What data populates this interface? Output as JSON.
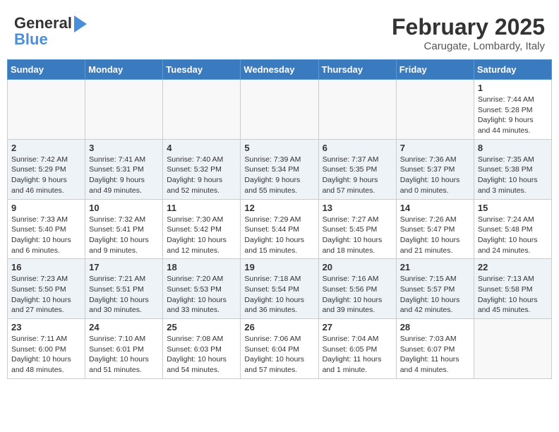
{
  "header": {
    "logo_line1": "General",
    "logo_line2": "Blue",
    "month": "February 2025",
    "location": "Carugate, Lombardy, Italy"
  },
  "days_of_week": [
    "Sunday",
    "Monday",
    "Tuesday",
    "Wednesday",
    "Thursday",
    "Friday",
    "Saturday"
  ],
  "weeks": [
    [
      {
        "day": "",
        "info": ""
      },
      {
        "day": "",
        "info": ""
      },
      {
        "day": "",
        "info": ""
      },
      {
        "day": "",
        "info": ""
      },
      {
        "day": "",
        "info": ""
      },
      {
        "day": "",
        "info": ""
      },
      {
        "day": "1",
        "info": "Sunrise: 7:44 AM\nSunset: 5:28 PM\nDaylight: 9 hours and 44 minutes."
      }
    ],
    [
      {
        "day": "2",
        "info": "Sunrise: 7:42 AM\nSunset: 5:29 PM\nDaylight: 9 hours and 46 minutes."
      },
      {
        "day": "3",
        "info": "Sunrise: 7:41 AM\nSunset: 5:31 PM\nDaylight: 9 hours and 49 minutes."
      },
      {
        "day": "4",
        "info": "Sunrise: 7:40 AM\nSunset: 5:32 PM\nDaylight: 9 hours and 52 minutes."
      },
      {
        "day": "5",
        "info": "Sunrise: 7:39 AM\nSunset: 5:34 PM\nDaylight: 9 hours and 55 minutes."
      },
      {
        "day": "6",
        "info": "Sunrise: 7:37 AM\nSunset: 5:35 PM\nDaylight: 9 hours and 57 minutes."
      },
      {
        "day": "7",
        "info": "Sunrise: 7:36 AM\nSunset: 5:37 PM\nDaylight: 10 hours and 0 minutes."
      },
      {
        "day": "8",
        "info": "Sunrise: 7:35 AM\nSunset: 5:38 PM\nDaylight: 10 hours and 3 minutes."
      }
    ],
    [
      {
        "day": "9",
        "info": "Sunrise: 7:33 AM\nSunset: 5:40 PM\nDaylight: 10 hours and 6 minutes."
      },
      {
        "day": "10",
        "info": "Sunrise: 7:32 AM\nSunset: 5:41 PM\nDaylight: 10 hours and 9 minutes."
      },
      {
        "day": "11",
        "info": "Sunrise: 7:30 AM\nSunset: 5:42 PM\nDaylight: 10 hours and 12 minutes."
      },
      {
        "day": "12",
        "info": "Sunrise: 7:29 AM\nSunset: 5:44 PM\nDaylight: 10 hours and 15 minutes."
      },
      {
        "day": "13",
        "info": "Sunrise: 7:27 AM\nSunset: 5:45 PM\nDaylight: 10 hours and 18 minutes."
      },
      {
        "day": "14",
        "info": "Sunrise: 7:26 AM\nSunset: 5:47 PM\nDaylight: 10 hours and 21 minutes."
      },
      {
        "day": "15",
        "info": "Sunrise: 7:24 AM\nSunset: 5:48 PM\nDaylight: 10 hours and 24 minutes."
      }
    ],
    [
      {
        "day": "16",
        "info": "Sunrise: 7:23 AM\nSunset: 5:50 PM\nDaylight: 10 hours and 27 minutes."
      },
      {
        "day": "17",
        "info": "Sunrise: 7:21 AM\nSunset: 5:51 PM\nDaylight: 10 hours and 30 minutes."
      },
      {
        "day": "18",
        "info": "Sunrise: 7:20 AM\nSunset: 5:53 PM\nDaylight: 10 hours and 33 minutes."
      },
      {
        "day": "19",
        "info": "Sunrise: 7:18 AM\nSunset: 5:54 PM\nDaylight: 10 hours and 36 minutes."
      },
      {
        "day": "20",
        "info": "Sunrise: 7:16 AM\nSunset: 5:56 PM\nDaylight: 10 hours and 39 minutes."
      },
      {
        "day": "21",
        "info": "Sunrise: 7:15 AM\nSunset: 5:57 PM\nDaylight: 10 hours and 42 minutes."
      },
      {
        "day": "22",
        "info": "Sunrise: 7:13 AM\nSunset: 5:58 PM\nDaylight: 10 hours and 45 minutes."
      }
    ],
    [
      {
        "day": "23",
        "info": "Sunrise: 7:11 AM\nSunset: 6:00 PM\nDaylight: 10 hours and 48 minutes."
      },
      {
        "day": "24",
        "info": "Sunrise: 7:10 AM\nSunset: 6:01 PM\nDaylight: 10 hours and 51 minutes."
      },
      {
        "day": "25",
        "info": "Sunrise: 7:08 AM\nSunset: 6:03 PM\nDaylight: 10 hours and 54 minutes."
      },
      {
        "day": "26",
        "info": "Sunrise: 7:06 AM\nSunset: 6:04 PM\nDaylight: 10 hours and 57 minutes."
      },
      {
        "day": "27",
        "info": "Sunrise: 7:04 AM\nSunset: 6:05 PM\nDaylight: 11 hours and 1 minute."
      },
      {
        "day": "28",
        "info": "Sunrise: 7:03 AM\nSunset: 6:07 PM\nDaylight: 11 hours and 4 minutes."
      },
      {
        "day": "",
        "info": ""
      }
    ]
  ]
}
